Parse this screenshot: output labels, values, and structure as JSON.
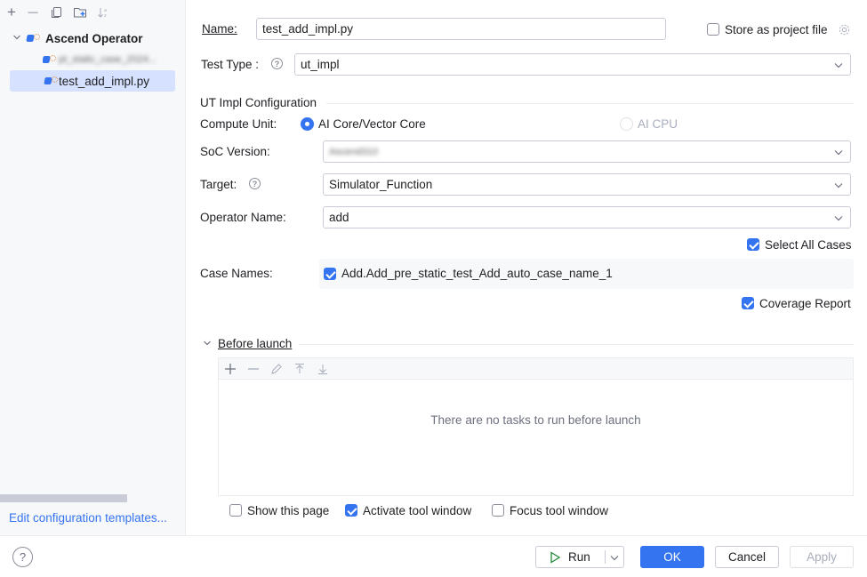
{
  "sidebar": {
    "toolbar": {
      "add": "+",
      "remove": "—"
    },
    "tree": {
      "root_label": "Ascend Operator",
      "items": [
        {
          "label": "pt_static_case_2024..."
        },
        {
          "label": "test_add_impl.py"
        }
      ]
    },
    "edit_templates": "Edit configuration templates..."
  },
  "form": {
    "name_label": "Name:",
    "name_value": "test_add_impl.py",
    "store_as_project_file": "Store as project file",
    "test_type_label": "Test Type :",
    "test_type_value": "ut_impl",
    "ut_config_title": "UT Impl Configuration",
    "compute_unit_label": "Compute Unit:",
    "compute_unit_options": [
      "AI Core/Vector Core",
      "AI CPU"
    ],
    "soc_version_label": "SoC Version:",
    "soc_version_value": "Ascend310",
    "target_label": "Target:",
    "target_value": "Simulator_Function",
    "operator_name_label": "Operator Name:",
    "operator_name_value": "add",
    "select_all_cases": "Select All Cases",
    "case_names_label": "Case Names:",
    "case_name_item": "Add.Add_pre_static_test_Add_auto_case_name_1",
    "coverage_report": "Coverage Report"
  },
  "before_launch": {
    "title": "Before launch",
    "empty_text": "There are no tasks to run before launch",
    "show_this_page": "Show this page",
    "activate_tool_window": "Activate tool window",
    "focus_tool_window": "Focus tool window"
  },
  "buttons": {
    "help": "?",
    "run": "Run",
    "ok": "OK",
    "cancel": "Cancel",
    "apply": "Apply"
  },
  "colors": {
    "accent": "#3574f0",
    "sidebar_bg": "#f7f8fa",
    "selection": "#d5e1ff"
  }
}
